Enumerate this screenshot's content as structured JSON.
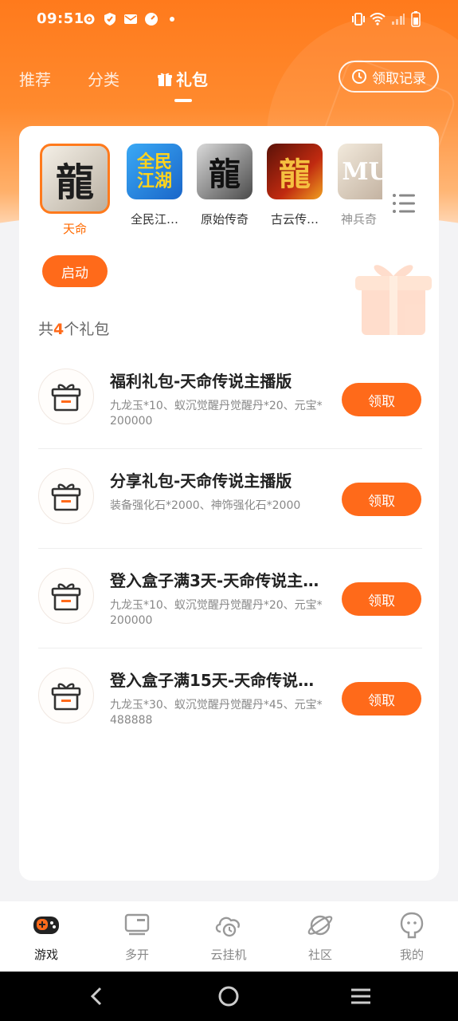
{
  "status_bar": {
    "time": "09:51"
  },
  "tabs": [
    {
      "label": "推荐"
    },
    {
      "label": "分类"
    },
    {
      "label": "礼包"
    }
  ],
  "record_button": {
    "label": "领取记录"
  },
  "games": [
    {
      "name": "天命",
      "selected": true
    },
    {
      "name": "全民江…"
    },
    {
      "name": "原始传奇"
    },
    {
      "name": "古云传…"
    },
    {
      "name": "神兵奇"
    }
  ],
  "start_button": {
    "label": "启动"
  },
  "gift_count": {
    "prefix": "共",
    "number": "4",
    "suffix": "个礼包"
  },
  "gifts": [
    {
      "title": "福利礼包-天命传说主播版",
      "desc": "九龙玉*10、蚁沉觉醒丹觉醒丹*20、元宝*200000",
      "button": "领取"
    },
    {
      "title": "分享礼包-天命传说主播版",
      "desc": "装备强化石*2000、神饰强化石*2000",
      "button": "领取"
    },
    {
      "title": "登入盒子满3天-天命传说主…",
      "desc": "九龙玉*10、蚁沉觉醒丹觉醒丹*20、元宝*200000",
      "button": "领取"
    },
    {
      "title": "登入盒子满15天-天命传说…",
      "desc": "九龙玉*30、蚁沉觉醒丹觉醒丹*45、元宝*488888",
      "button": "领取"
    }
  ],
  "bottom_nav": [
    {
      "label": "游戏",
      "icon": "gamepad-icon",
      "active": true
    },
    {
      "label": "多开",
      "icon": "multi-window-icon"
    },
    {
      "label": "云挂机",
      "icon": "cloud-clock-icon"
    },
    {
      "label": "社区",
      "icon": "planet-icon"
    },
    {
      "label": "我的",
      "icon": "profile-icon"
    }
  ],
  "colors": {
    "accent": "#ff6a1a",
    "header": "#ff7a1c"
  }
}
